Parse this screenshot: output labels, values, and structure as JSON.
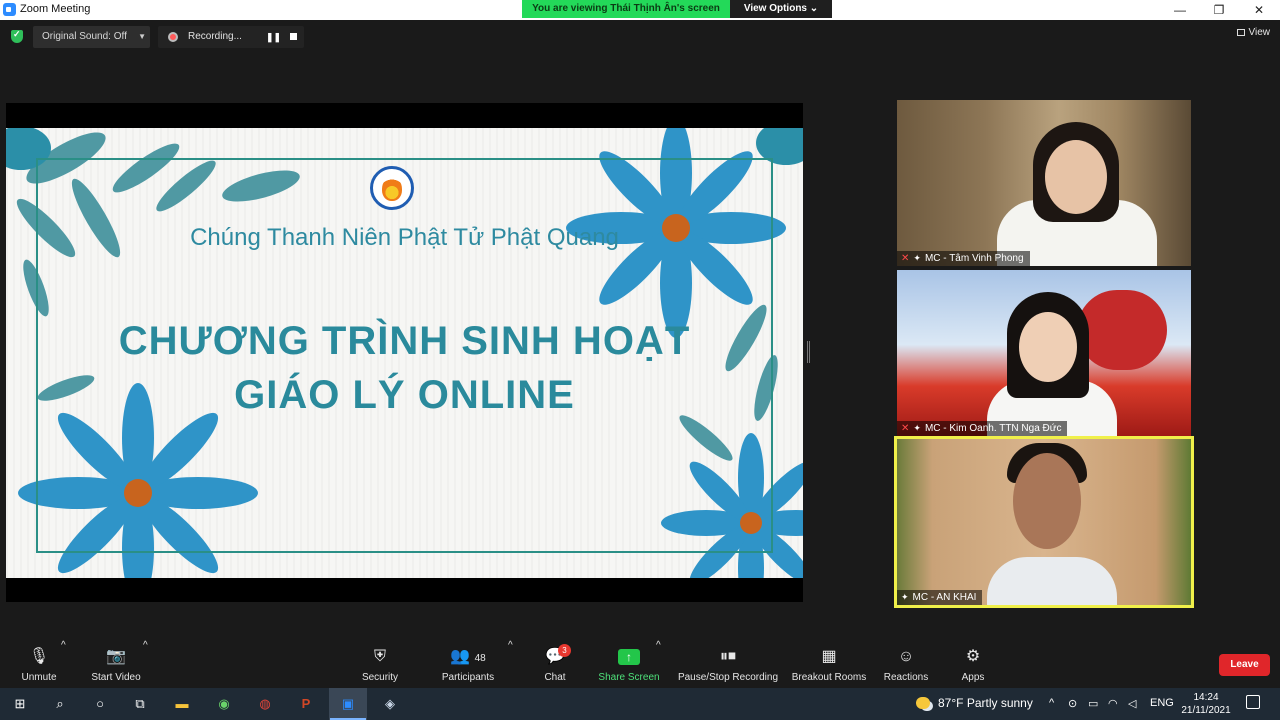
{
  "window": {
    "title": "Zoom Meeting",
    "viewing_banner": "You are viewing Thái Thịnh Ân's screen",
    "view_options": "View Options ⌄",
    "minimize": "—",
    "maximize": "❐",
    "close": "✕"
  },
  "top": {
    "original_sound": "Original Sound: Off",
    "recording": "Recording...",
    "view": "View"
  },
  "slide": {
    "subtitle": "Chúng Thanh Niên Phật Tử Phật Quang",
    "title_line1": "CHƯƠNG TRÌNH SINH HOẠT",
    "title_line2": "GIÁO LÝ ONLINE"
  },
  "participants": [
    {
      "name": "MC - Tâm Vinh Phong",
      "muted": true
    },
    {
      "name": "MC - Kim Oanh. TTN Nga Đức",
      "muted": true
    },
    {
      "name": "MC - AN KHAI",
      "muted": false,
      "active_speaker": true
    }
  ],
  "toolbar": {
    "unmute": "Unmute",
    "start_video": "Start Video",
    "security": "Security",
    "participants": "Participants",
    "participants_count": "48",
    "chat": "Chat",
    "chat_badge": "3",
    "share_screen": "Share Screen",
    "recording": "Pause/Stop Recording",
    "breakout": "Breakout Rooms",
    "reactions": "Reactions",
    "apps": "Apps",
    "leave": "Leave"
  },
  "taskbar": {
    "weather_temp": "87°F",
    "weather_desc": "Partly sunny",
    "language": "ENG",
    "time": "14:24",
    "date": "21/11/2021"
  },
  "colors": {
    "banner_green": "#23d959",
    "slide_teal": "#2a8a9c",
    "leave_red": "#e0262a",
    "active_speaker_border": "#f0f04a"
  }
}
